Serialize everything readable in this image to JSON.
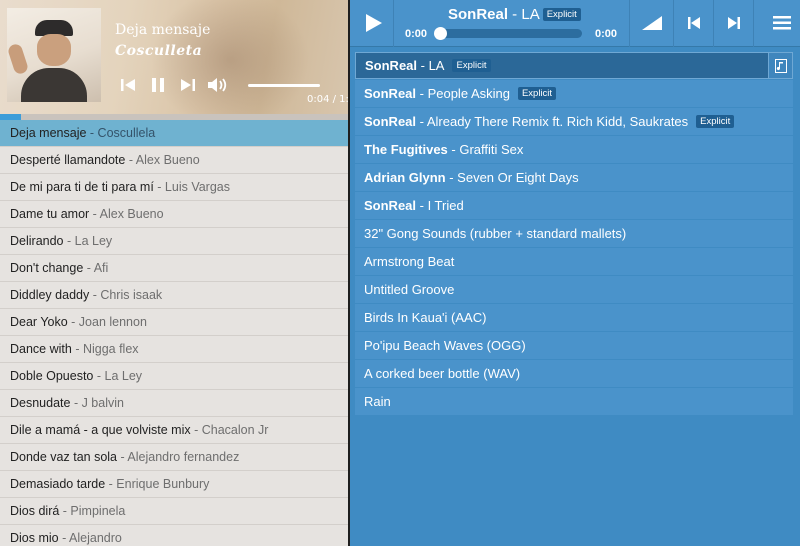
{
  "left_player": {
    "now_playing": {
      "title": "Deja mensaje",
      "artist": "Cosculleta",
      "time": "0:04 / 1:"
    },
    "progress": 0.06,
    "playlist": [
      {
        "title": "Deja mensaje",
        "artist": " - Coscullela",
        "active": true
      },
      {
        "title": "Desperté llamandote",
        "artist": " - Alex Bueno"
      },
      {
        "title": "De mi para ti de ti para mí",
        "artist": " - Luis Vargas"
      },
      {
        "title": "Dame tu amor",
        "artist": " - Alex Bueno"
      },
      {
        "title": "Delirando",
        "artist": " - La Ley"
      },
      {
        "title": "Don't change",
        "artist": " - Afi"
      },
      {
        "title": "Diddley daddy",
        "artist": " - Chris isaak"
      },
      {
        "title": "Dear Yoko",
        "artist": " - Joan lennon"
      },
      {
        "title": "Dance with",
        "artist": " - Nigga flex"
      },
      {
        "title": "Doble Opuesto",
        "artist": " - La Ley"
      },
      {
        "title": "Desnudate",
        "artist": " - J balvin"
      },
      {
        "title": "Dile a mamá - a que volviste mix",
        "artist": " - Chacalon Jr"
      },
      {
        "title": "Donde vaz tan sola",
        "artist": " - Alejandro fernandez"
      },
      {
        "title": "Demasiado tarde",
        "artist": " - Enrique Bunbury"
      },
      {
        "title": "Dios dirá",
        "artist": " - Pimpinela"
      },
      {
        "title": "Dios mio",
        "artist": " - Alejandro"
      }
    ],
    "icons": [
      "prev-icon",
      "pause-icon",
      "next-icon",
      "volume-icon"
    ]
  },
  "right_player": {
    "now_playing": {
      "artist": "SonReal",
      "separator": " - ",
      "title": "LA",
      "badge": "Explicit",
      "time_current": "0:00",
      "time_total": "0:00"
    },
    "progress": 0.0,
    "playlist": [
      {
        "artist": "SonReal",
        "title": " - LA",
        "badge": "Explicit",
        "active": true
      },
      {
        "artist": "SonReal",
        "title": " - People Asking",
        "badge": "Explicit"
      },
      {
        "artist": "SonReal",
        "title": " - Already There Remix ft. Rich Kidd, Saukrates",
        "badge": "Explicit"
      },
      {
        "artist": "The Fugitives",
        "title": " - Graffiti Sex"
      },
      {
        "artist": "Adrian Glynn",
        "title": " - Seven Or Eight Days"
      },
      {
        "artist": "SonReal",
        "title": " - I Tried"
      },
      {
        "artist": "",
        "title": "32\" Gong Sounds (rubber + standard mallets)"
      },
      {
        "artist": "",
        "title": "Armstrong Beat"
      },
      {
        "artist": "",
        "title": "Untitled Groove"
      },
      {
        "artist": "",
        "title": "Birds In Kaua'i (AAC)"
      },
      {
        "artist": "",
        "title": "Po'ipu Beach Waves (OGG)"
      },
      {
        "artist": "",
        "title": "A corked beer bottle (WAV)"
      },
      {
        "artist": "",
        "title": "Rain"
      }
    ],
    "icons": [
      "play-icon",
      "volume-icon",
      "prev-icon",
      "next-icon",
      "menu-icon",
      "music-note-icon"
    ]
  },
  "colors": {
    "left_active_row": "#6fb2d0",
    "left_progress": "#3d9dd9",
    "right_background": "#3f8bc3",
    "right_active_row": "#2b6898",
    "badge": "#1f5f92"
  }
}
